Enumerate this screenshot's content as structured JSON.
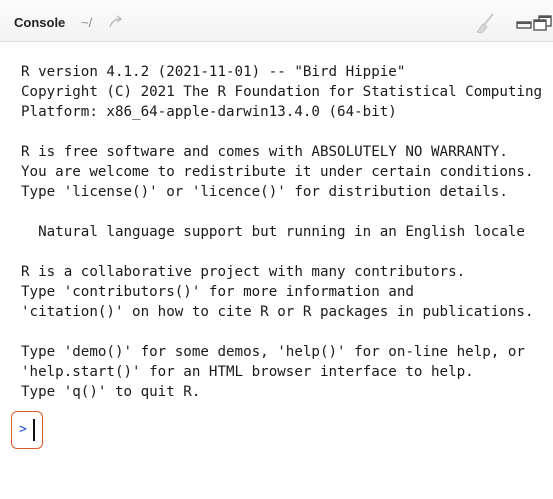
{
  "header": {
    "title": "Console",
    "path": "~/"
  },
  "icons": {
    "goto": "go-to-directory-arrow-icon",
    "clear": "broom-icon",
    "minimize": "minimize-icon",
    "maximize": "maximize-icon"
  },
  "console": {
    "lines": [
      "R version 4.1.2 (2021-11-01) -- \"Bird Hippie\"",
      "Copyright (C) 2021 The R Foundation for Statistical Computing",
      "Platform: x86_64-apple-darwin13.4.0 (64-bit)",
      "R is free software and comes with ABSOLUTELY NO WARRANTY.",
      "You are welcome to redistribute it under certain conditions.",
      "Type 'license()' or 'licence()' for distribution details.",
      "  Natural language support but running in an English locale",
      "R is a collaborative project with many contributors.",
      "Type 'contributors()' for more information and",
      "'citation()' on how to cite R or R packages in publications.",
      "Type 'demo()' for some demos, 'help()' for on-line help, or",
      "'help.start()' for an HTML browser interface to help.",
      "Type 'q()' to quit R."
    ],
    "prompt": ">",
    "input_value": ""
  },
  "colors": {
    "prompt": "#1a4fc4",
    "highlight_box": "#e0592c",
    "text": "#1a1a1a",
    "path_text": "#8c8c8c"
  }
}
